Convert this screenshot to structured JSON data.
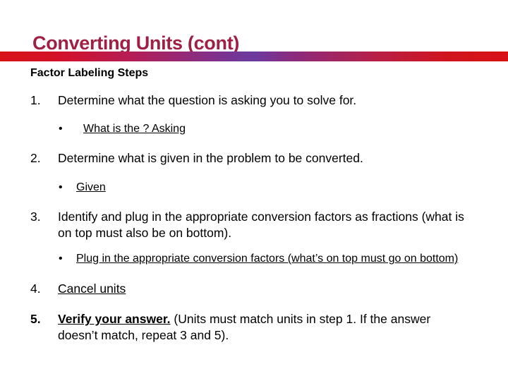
{
  "slide": {
    "title": "Converting Units (cont)",
    "title_color": "#9e2044",
    "rule_colors": {
      "left": "#d81216",
      "middle": "#6b3a9e",
      "right": "#d81216"
    },
    "subhead": "Factor Labeling Steps",
    "bullet_glyph": "•",
    "steps": [
      {
        "number": "1.",
        "text": "Determine what the question is asking you to solve for.",
        "sub": [
          {
            "bullet": "•",
            "text": "What is the ? Asking"
          }
        ]
      },
      {
        "number": "2.",
        "text": "Determine what is given in the problem to be converted.",
        "sub": [
          {
            "bullet": "•",
            "text": "Given"
          }
        ]
      },
      {
        "number": "3.",
        "text": "Identify and plug in the appropriate conversion factors as fractions (what is on top must also be on bottom).",
        "sub": [
          {
            "bullet": "•",
            "text": "Plug in the appropriate conversion factors (what’s on top must go on bottom)"
          }
        ]
      },
      {
        "number": "4.",
        "text": "Cancel units",
        "sub": []
      },
      {
        "number": "5.",
        "text_emphasis": "Verify your answer.",
        "text_rest": " (Units must match units in step 1.  If the answer doesn’t match, repeat 3 and 5).",
        "sub": []
      }
    ]
  }
}
